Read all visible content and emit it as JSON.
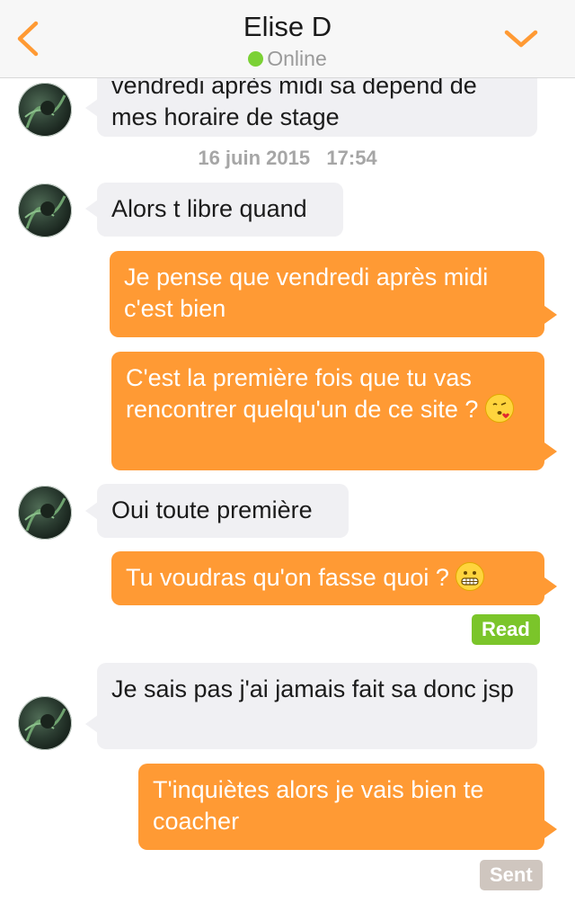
{
  "header": {
    "contact_name": "Elise D",
    "status": "Online",
    "status_color": "#7bd135",
    "accent_color": "#ff9a34",
    "back_icon": "chevron-left-icon",
    "menu_icon": "chevron-down-icon"
  },
  "messages": [
    {
      "from": "them",
      "text": "vendredi après midi sa depend de mes horaire de stage"
    },
    {
      "from": "them",
      "text": "Alors t libre quand"
    },
    {
      "from": "me",
      "text": "Je pense que vendredi après midi c'est bien"
    },
    {
      "from": "me",
      "text": "C'est la première fois que tu vas rencontrer quelqu'un de ce site ?",
      "emoji": "kissing-heart-emoji"
    },
    {
      "from": "them",
      "text": "Oui toute première"
    },
    {
      "from": "me",
      "text": "Tu voudras qu'on fasse quoi ?",
      "emoji": "grimacing-emoji"
    },
    {
      "from": "them",
      "text": "Je sais pas j'ai jamais fait sa donc jsp"
    },
    {
      "from": "me",
      "text": "T'inquiètes alors je vais bien te coacher"
    }
  ],
  "timestamp": "16 juin 2015   17:54",
  "read_label": "Read",
  "read_color": "#7bc52a",
  "sent_label": "Sent",
  "sent_color": "#cfc6bf"
}
